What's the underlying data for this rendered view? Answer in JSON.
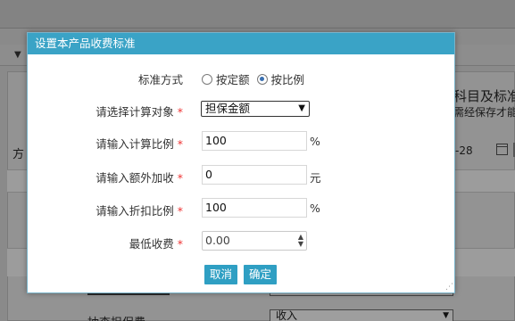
{
  "background": {
    "right_text_1": "科目及标准",
    "right_text_2": "需经保存才能",
    "left_label": "方",
    "date_fragment": "-28",
    "row_select_value": "收入",
    "row_label": "抽查担保费"
  },
  "dialog": {
    "title": "设置本产品收费标准",
    "standard_mode": {
      "label": "标准方式",
      "options": [
        "按定额",
        "按比例"
      ],
      "selected": "按比例"
    },
    "calc_target": {
      "label": "请选择计算对象",
      "required_mark": "*",
      "value": "担保金额"
    },
    "calc_ratio": {
      "label": "请输入计算比例",
      "required_mark": "*",
      "value": "100",
      "unit": "%"
    },
    "extra_fee": {
      "label": "请输入额外加收",
      "required_mark": "*",
      "value": "0",
      "unit": "元"
    },
    "discount_ratio": {
      "label": "请输入折扣比例",
      "required_mark": "*",
      "value": "100",
      "unit": "%"
    },
    "min_fee": {
      "label": "最低收费",
      "required_mark": "*",
      "value": "0.00"
    },
    "buttons": {
      "cancel": "取消",
      "confirm": "确定"
    }
  },
  "colors": {
    "title_bar": "#3aa3c6",
    "button": "#2f9fc3",
    "required": "#e33333"
  }
}
